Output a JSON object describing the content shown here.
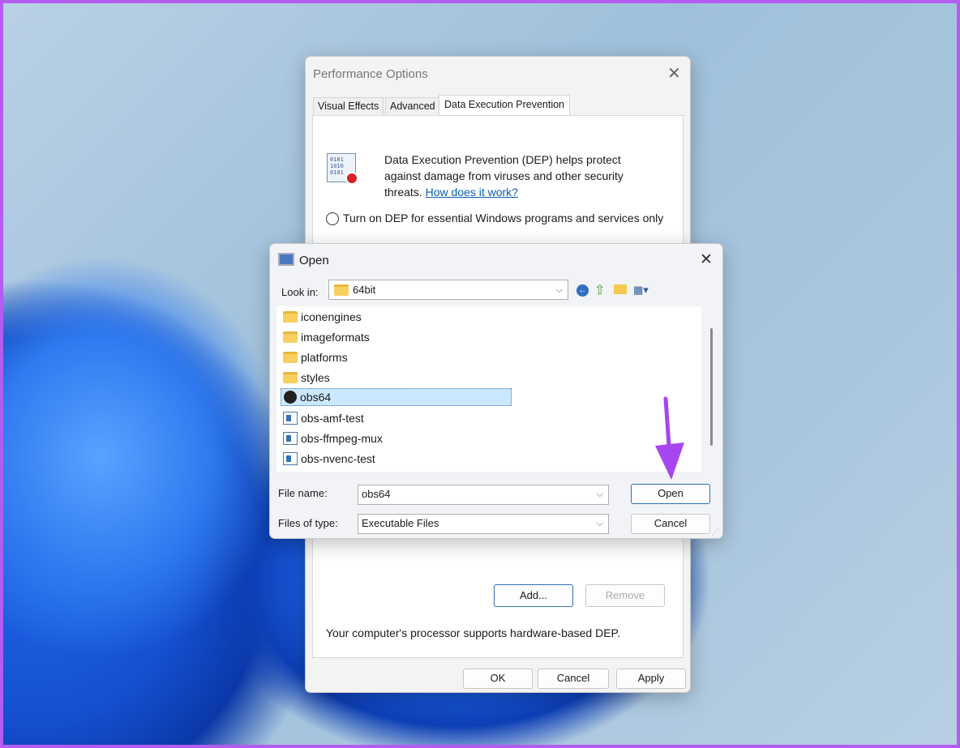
{
  "perf": {
    "title": "Performance Options",
    "tabs": [
      "Visual Effects",
      "Advanced",
      "Data Execution Prevention"
    ],
    "description": "Data Execution Prevention (DEP) helps protect against damage from viruses and other security threats.",
    "link": "How does it work?",
    "radio_label": "Turn on DEP for essential Windows programs and services only",
    "add": "Add...",
    "remove": "Remove",
    "support_text": "Your computer's processor supports hardware-based DEP.",
    "ok": "OK",
    "cancel": "Cancel",
    "apply": "Apply"
  },
  "open": {
    "title": "Open",
    "look_in_label": "Look in:",
    "look_in_value": "64bit",
    "items": [
      {
        "name": "iconengines",
        "type": "folder"
      },
      {
        "name": "imageformats",
        "type": "folder"
      },
      {
        "name": "platforms",
        "type": "folder"
      },
      {
        "name": "styles",
        "type": "folder"
      },
      {
        "name": "obs64",
        "type": "obs",
        "selected": true
      },
      {
        "name": "obs-amf-test",
        "type": "exe"
      },
      {
        "name": "obs-ffmpeg-mux",
        "type": "exe"
      },
      {
        "name": "obs-nvenc-test",
        "type": "exe"
      }
    ],
    "file_name_label": "File name:",
    "file_name_value": "obs64",
    "file_type_label": "Files of type:",
    "file_type_value": "Executable Files",
    "open_button": "Open",
    "cancel_button": "Cancel"
  },
  "colors": {
    "accent_arrow": "#a646f0",
    "link": "#0b5cad",
    "selection": "#cce8ff"
  }
}
